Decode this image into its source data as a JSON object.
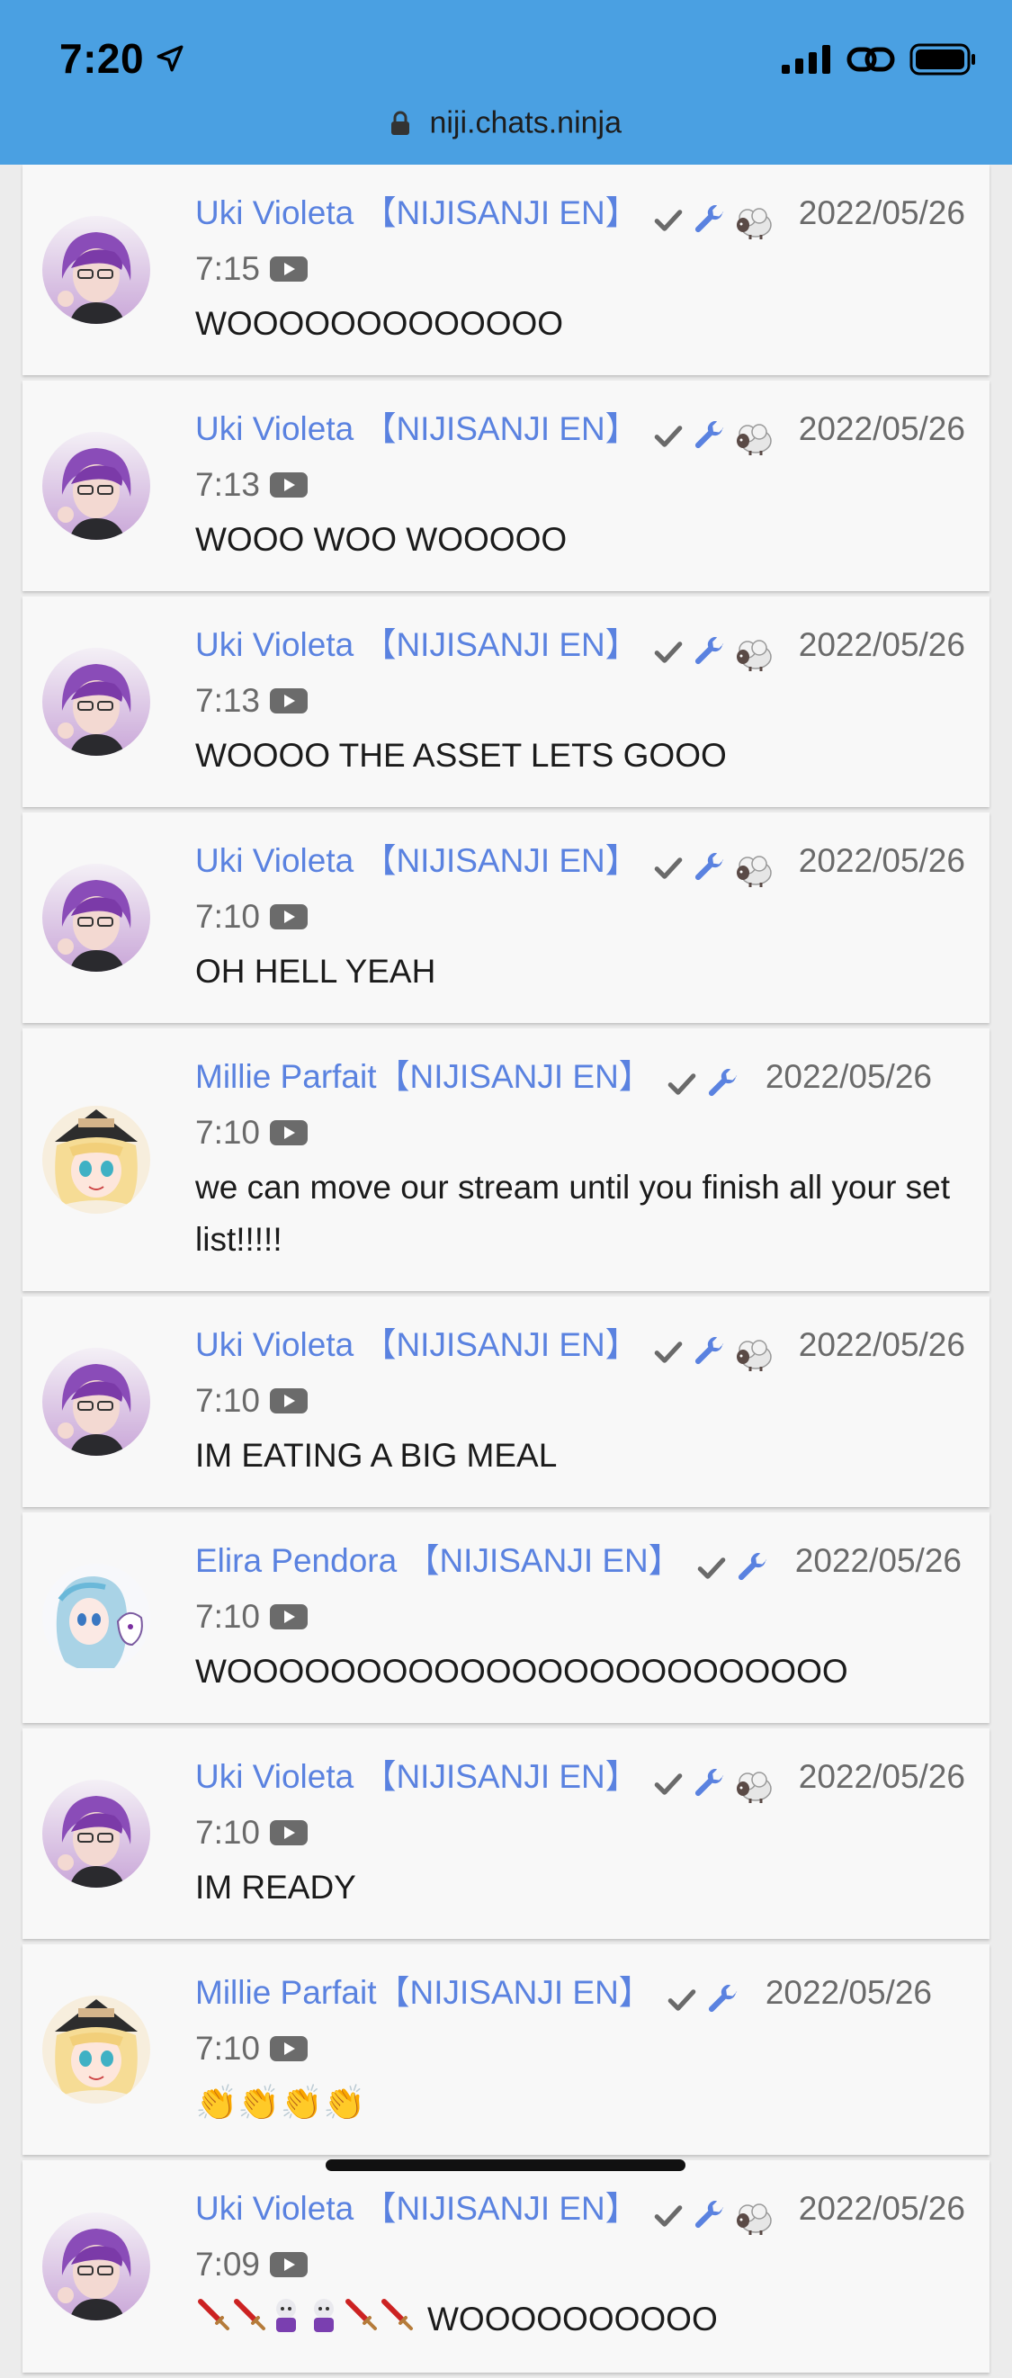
{
  "status_bar": {
    "time": "7:20",
    "url": "niji.chats.ninja"
  },
  "colors": {
    "header": "#4aa0e2",
    "author": "#5a82e0"
  },
  "messages": [
    {
      "author": "Uki Violeta 【NIJISANJI EN】",
      "badges": [
        "check-icon",
        "wrench-icon",
        "sheep-icon"
      ],
      "timestamp": "2022/05/26 7:15",
      "text": "WOOOOOOOOOOOOO",
      "avatar": "uki"
    },
    {
      "author": "Uki Violeta 【NIJISANJI EN】",
      "badges": [
        "check-icon",
        "wrench-icon",
        "sheep-icon"
      ],
      "timestamp": "2022/05/26 7:13",
      "text": "WOOO WOO WOOOOO",
      "avatar": "uki"
    },
    {
      "author": "Uki Violeta 【NIJISANJI EN】",
      "badges": [
        "check-icon",
        "wrench-icon",
        "sheep-icon"
      ],
      "timestamp": "2022/05/26 7:13",
      "text": "WOOOO THE ASSET LETS GOOO",
      "avatar": "uki"
    },
    {
      "author": "Uki Violeta 【NIJISANJI EN】",
      "badges": [
        "check-icon",
        "wrench-icon",
        "sheep-icon"
      ],
      "timestamp": "2022/05/26 7:10",
      "text": "OH HELL YEAH",
      "avatar": "uki"
    },
    {
      "author": "Millie Parfait【NIJISANJI EN】",
      "badges": [
        "check-icon",
        "wrench-icon"
      ],
      "timestamp": "2022/05/26 7:10",
      "text": "we can move our stream until you finish all your set list!!!!!",
      "avatar": "millie"
    },
    {
      "author": "Uki Violeta 【NIJISANJI EN】",
      "badges": [
        "check-icon",
        "wrench-icon",
        "sheep-icon"
      ],
      "timestamp": "2022/05/26 7:10",
      "text": "IM EATING A BIG MEAL",
      "avatar": "uki"
    },
    {
      "author": "Elira Pendora 【NIJISANJI EN】",
      "badges": [
        "check-icon",
        "wrench-icon"
      ],
      "timestamp": "2022/05/26 7:10",
      "text": "WOOOOOOOOOOOOOOOOOOOOOOOO",
      "avatar": "elira"
    },
    {
      "author": "Uki Violeta 【NIJISANJI EN】",
      "badges": [
        "check-icon",
        "wrench-icon",
        "sheep-icon"
      ],
      "timestamp": "2022/05/26 7:10",
      "text": "IM READY",
      "avatar": "uki"
    },
    {
      "author": "Millie Parfait【NIJISANJI EN】",
      "badges": [
        "check-icon",
        "wrench-icon"
      ],
      "timestamp": "2022/05/26 7:10",
      "text": "👏👏👏👏",
      "avatar": "millie"
    },
    {
      "author": "Uki Violeta 【NIJISANJI EN】",
      "badges": [
        "check-icon",
        "wrench-icon",
        "sheep-icon"
      ],
      "timestamp": "2022/05/26 7:09",
      "text": "WOOOOOOOOOO",
      "avatar": "uki",
      "leading_emotes": [
        "sword-emote",
        "sword-emote",
        "character-emote",
        "character-emote",
        "sword-emote",
        "sword-emote"
      ]
    }
  ]
}
